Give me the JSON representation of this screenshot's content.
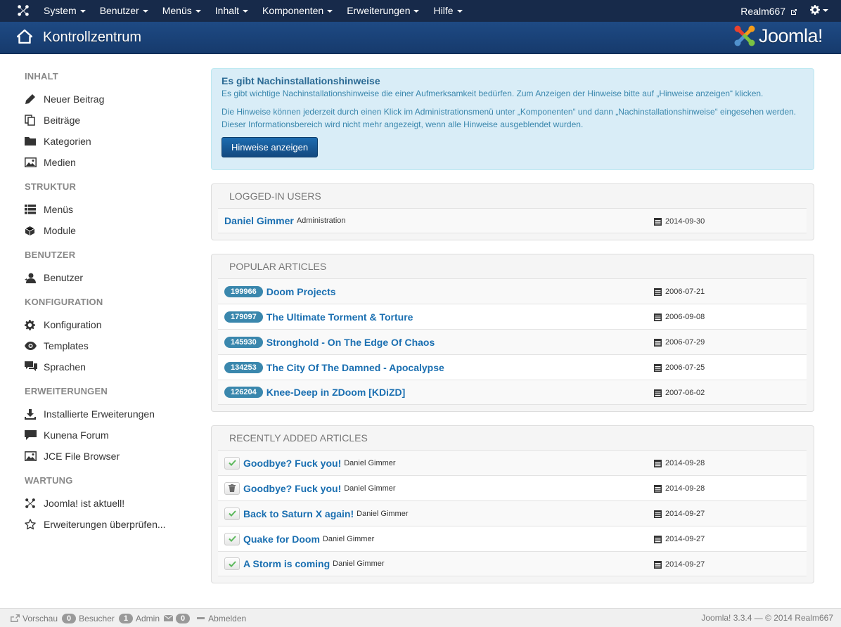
{
  "navbar": {
    "menu": [
      {
        "label": "System"
      },
      {
        "label": "Benutzer"
      },
      {
        "label": "Menüs"
      },
      {
        "label": "Inhalt"
      },
      {
        "label": "Komponenten"
      },
      {
        "label": "Erweiterungen"
      },
      {
        "label": "Hilfe"
      }
    ],
    "user": "Realm667"
  },
  "header": {
    "title": "Kontrollzentrum",
    "logo_text": "Joomla!"
  },
  "sidebar": {
    "sections": [
      {
        "heading": "INHALT",
        "items": [
          {
            "label": "Neuer Beitrag",
            "icon": "pencil-icon"
          },
          {
            "label": "Beiträge",
            "icon": "copy-icon"
          },
          {
            "label": "Kategorien",
            "icon": "folder-icon"
          },
          {
            "label": "Medien",
            "icon": "image-icon"
          }
        ]
      },
      {
        "heading": "STRUKTUR",
        "items": [
          {
            "label": "Menüs",
            "icon": "list-icon"
          },
          {
            "label": "Module",
            "icon": "cube-icon"
          }
        ]
      },
      {
        "heading": "BENUTZER",
        "items": [
          {
            "label": "Benutzer",
            "icon": "user-icon"
          }
        ]
      },
      {
        "heading": "KONFIGURATION",
        "items": [
          {
            "label": "Konfiguration",
            "icon": "cog-icon"
          },
          {
            "label": "Templates",
            "icon": "eye-icon"
          },
          {
            "label": "Sprachen",
            "icon": "comments-icon"
          }
        ]
      },
      {
        "heading": "ERWEITERUNGEN",
        "items": [
          {
            "label": "Installierte Erweiterungen",
            "icon": "download-icon"
          },
          {
            "label": "Kunena Forum",
            "icon": "comment-icon"
          },
          {
            "label": "JCE File Browser",
            "icon": "image-icon"
          }
        ]
      },
      {
        "heading": "WARTUNG",
        "items": [
          {
            "label": "Joomla! ist aktuell!",
            "icon": "joomla-icon"
          },
          {
            "label": "Erweiterungen überprüfen...",
            "icon": "star-icon"
          }
        ]
      }
    ]
  },
  "alert": {
    "heading": "Es gibt Nachinstallationshinweise",
    "p1": "Es gibt wichtige Nachinstallationshinweise die einer Aufmerksamkeit bedürfen. Zum Anzeigen der Hinweise bitte auf „Hinweise anzeigen“ klicken.",
    "p2": "Die Hinweise können jederzeit durch einen Klick im Administrationsmenü unter „Komponenten“ und dann „Nachinstallationshinweise“ eingesehen werden. Dieser Informationsbereich wird nicht mehr angezeigt, wenn alle Hinweise ausgeblendet wurden.",
    "button": "Hinweise anzeigen"
  },
  "logged_in": {
    "heading": "LOGGED-IN USERS",
    "rows": [
      {
        "name": "Daniel Gimmer",
        "area": "Administration",
        "date": "2014-09-30"
      }
    ]
  },
  "popular": {
    "heading": "POPULAR ARTICLES",
    "rows": [
      {
        "hits": "199966",
        "title": "Doom Projects",
        "date": "2006-07-21"
      },
      {
        "hits": "179097",
        "title": "The Ultimate Torment & Torture",
        "date": "2006-09-08"
      },
      {
        "hits": "145930",
        "title": "Stronghold - On The Edge Of Chaos",
        "date": "2006-07-29"
      },
      {
        "hits": "134253",
        "title": "The City Of The Damned - Apocalypse",
        "date": "2006-07-25"
      },
      {
        "hits": "126204",
        "title": "Knee-Deep in ZDoom [KDiZD]",
        "date": "2007-06-02"
      }
    ]
  },
  "recent": {
    "heading": "RECENTLY ADDED ARTICLES",
    "rows": [
      {
        "state": "published",
        "title": "Goodbye? Fuck you!",
        "author": "Daniel Gimmer",
        "date": "2014-09-28"
      },
      {
        "state": "trashed",
        "title": "Goodbye? Fuck you!",
        "author": "Daniel Gimmer",
        "date": "2014-09-28"
      },
      {
        "state": "published",
        "title": "Back to Saturn X again!",
        "author": "Daniel Gimmer",
        "date": "2014-09-27"
      },
      {
        "state": "published",
        "title": "Quake for Doom",
        "author": "Daniel Gimmer",
        "date": "2014-09-27"
      },
      {
        "state": "published",
        "title": "A Storm is coming",
        "author": "Daniel Gimmer",
        "date": "2014-09-27"
      }
    ]
  },
  "footer": {
    "preview": "Vorschau",
    "visitors_count": "0",
    "visitors_label": "Besucher",
    "admin_count": "1",
    "admin_label": "Admin",
    "messages_count": "0",
    "logout": "Abmelden",
    "version": "Joomla! 3.3.4 — © 2014 Realm667"
  },
  "colors": {
    "navbar": "#172a4a",
    "header": "#1e4a84",
    "link": "#1a6fb1",
    "badge": "#3a87ad",
    "alert_bg": "#d9edf7"
  }
}
